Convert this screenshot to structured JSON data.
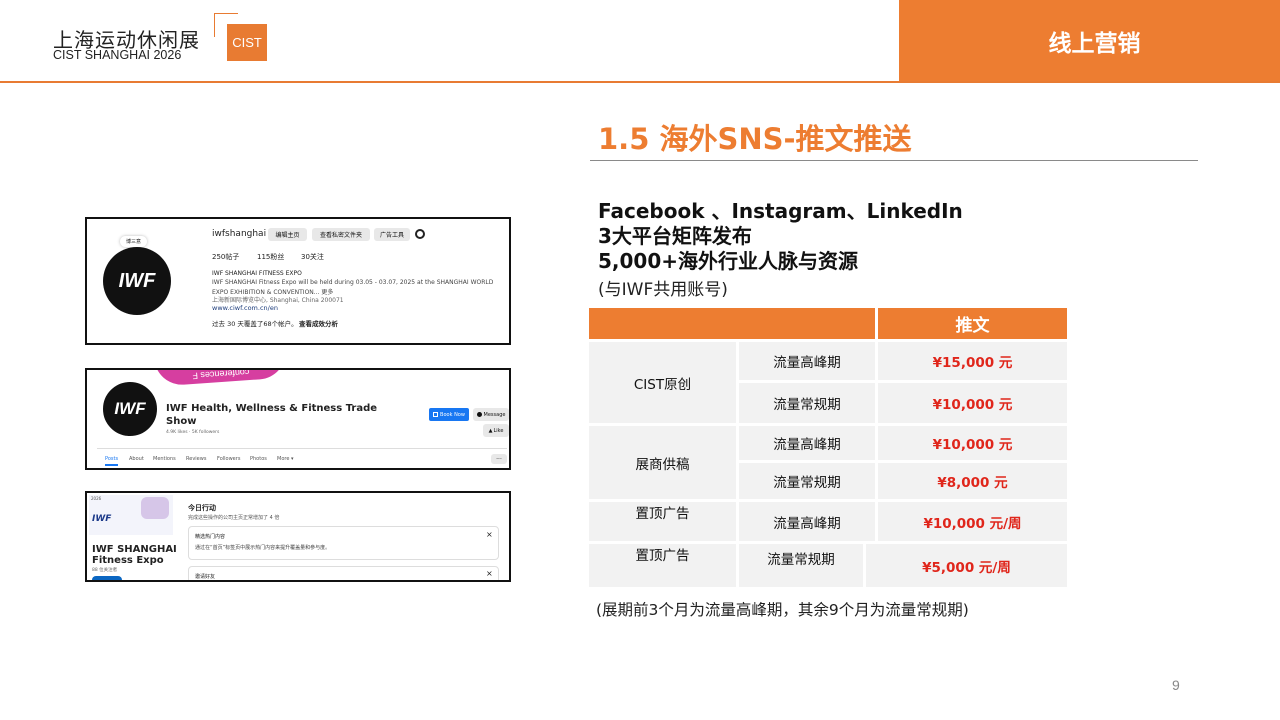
{
  "header": {
    "logo_cn": "上海运动休闲展",
    "logo_en": "CIST SHANGHAI 2026",
    "logo_badge": "CIST",
    "section_tab": "线上营销"
  },
  "section_title": "1.5 海外SNS-推文推送",
  "intro": {
    "line1": "Facebook 、Instagram、LinkedIn",
    "line2": "3大平台矩阵发布",
    "line3": "5,000+海外行业人脉与资源",
    "line4": "(与IWF共用账号)"
  },
  "table": {
    "header": "推文",
    "groups": [
      "CIST原创",
      "展商供稿",
      "置顶广告",
      "置顶广告"
    ],
    "rows": [
      {
        "period": "流量高峰期",
        "price": "¥15,000 元"
      },
      {
        "period": "流量常规期",
        "price": "¥10,000 元"
      },
      {
        "period": "流量高峰期",
        "price": "¥10,000 元"
      },
      {
        "period": "流量常规期",
        "price": "¥8,000 元"
      },
      {
        "period": "流量高峰期",
        "price": "¥10,000 元/周"
      },
      {
        "period": "流量常规期",
        "price": "¥5,000 元/周"
      }
    ]
  },
  "note": "(展期前3个月为流量高峰期，其余9个月为流量常规期)",
  "page_number": "9",
  "shot1": {
    "logo": "IWF",
    "tag": "博三意",
    "username": "iwfshanghai",
    "btn_edit": "编辑主页",
    "btn_archive": "查看私密文件夹",
    "btn_ads": "广告工具",
    "posts": "250帖子",
    "followers": "115粉丝",
    "following": "30关注",
    "bio_name": "IWF SHANGHAI FITNESS EXPO",
    "bio_line1": "IWF SHANGHAI Fitness Expo will be held during 03.05 - 03.07, 2025 at the SHANGHAI WORLD",
    "bio_line2": "EXPO EXHIBITION & CONVENTION... 更多",
    "bio_line3": "上海新国际博览中心, Shanghai, China 200071",
    "bio_link": "www.ciwf.com.cn/en",
    "reach": "过去 30 天覆盖了68个帐户。",
    "reach_link": "查看成效分析"
  },
  "shot2": {
    "logo": "IWF",
    "banner": "conferences  F",
    "page_name_1": "IWF Health, Wellness & Fitness Trade",
    "page_name_2": "Show",
    "stats": "4.9K likes · 5K followers",
    "btn_book": "Book Now",
    "btn_message": "Message",
    "btn_like": "Like",
    "tabs": [
      "Posts",
      "About",
      "Mentions",
      "Reviews",
      "Followers",
      "Photos",
      "More ▾"
    ],
    "more": "···"
  },
  "shot3": {
    "banner_text": "IWF",
    "banner_year": "2026",
    "company_1": "IWF SHANGHAI",
    "company_2": "Fitness Expo",
    "company_sub": "88 位关注者",
    "today_title": "今日行动",
    "today_sub": "完成这些操作的公司主页正常增加了 4 倍",
    "card1_title": "精选热门内容",
    "card1_text": "通过在“首页”标签页中展示热门内容来提升覆盖量和参与度。",
    "card2_title": "邀请好友",
    "close": "×"
  }
}
